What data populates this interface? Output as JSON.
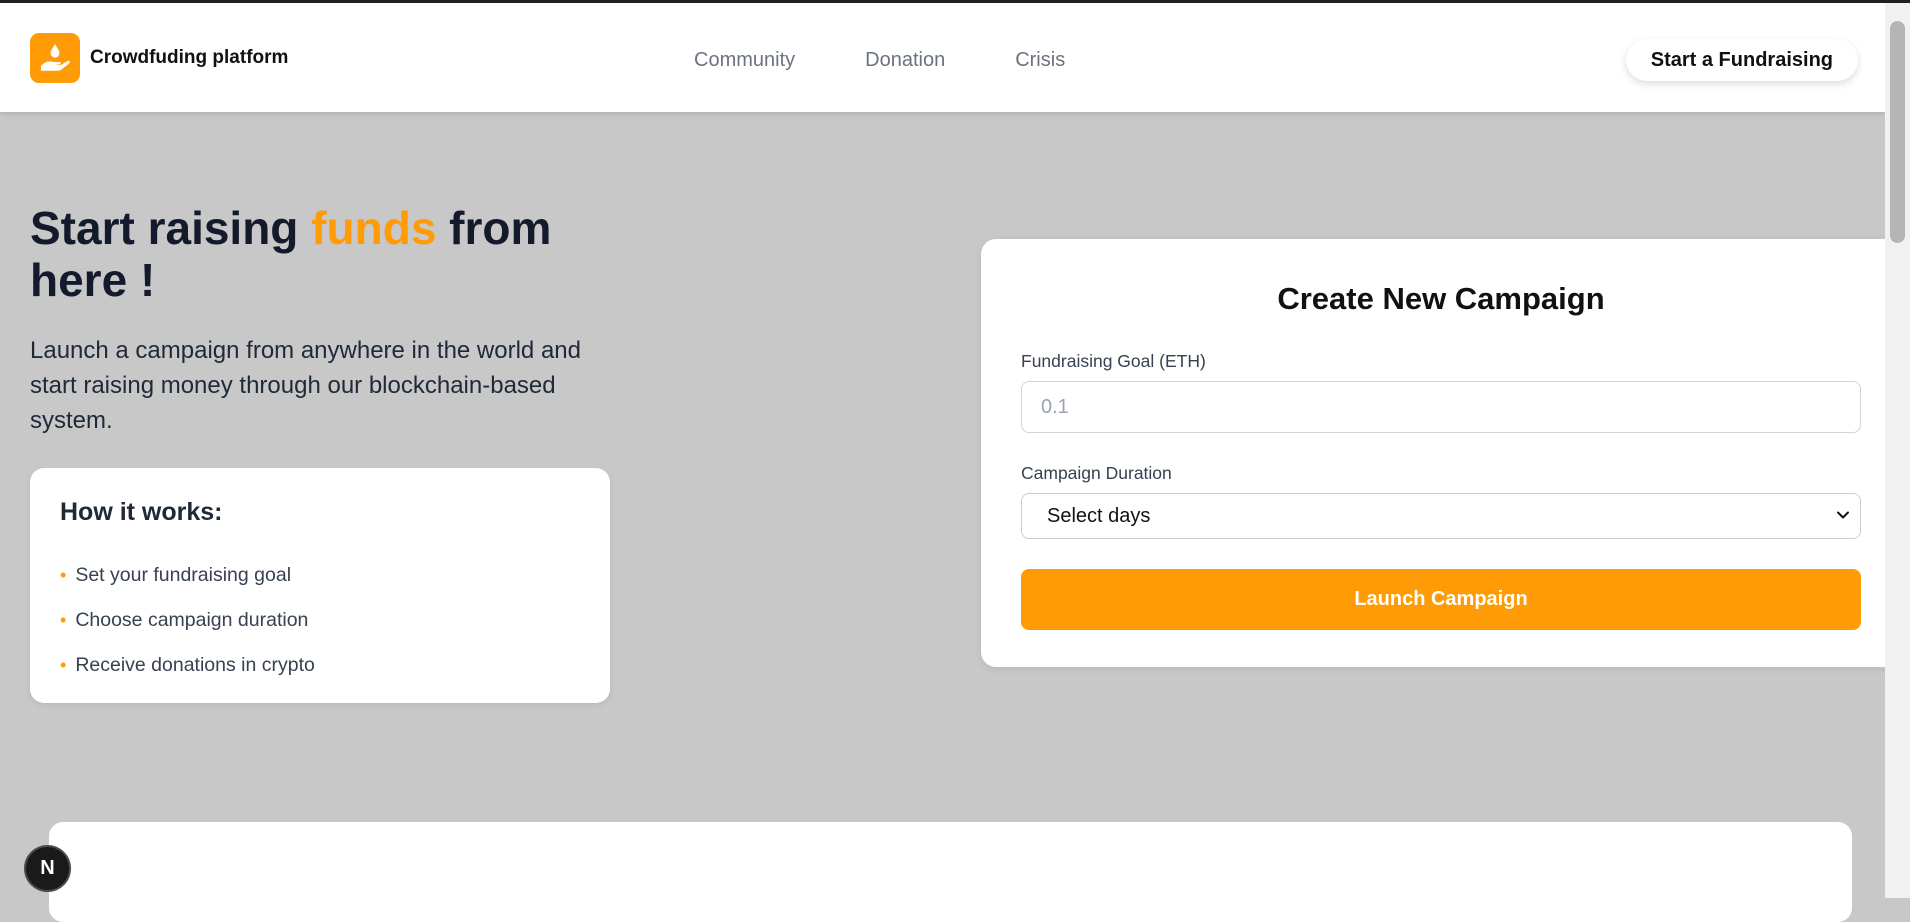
{
  "header": {
    "brand_name": "Crowdfuding platform",
    "nav": [
      "Community",
      "Donation",
      "Crisis"
    ],
    "cta_label": "Start a Fundraising"
  },
  "hero": {
    "title_part1": "Start raising ",
    "title_accent": "funds",
    "title_part2": " from here !",
    "description": "Launch a campaign from anywhere in the world and start raising money through our blockchain-based system."
  },
  "how_it_works": {
    "title": "How it works:",
    "items": [
      "Set your fundraising goal",
      "Choose campaign duration",
      "Receive donations in crypto"
    ]
  },
  "campaign_form": {
    "title": "Create New Campaign",
    "goal_label": "Fundraising Goal (ETH)",
    "goal_placeholder": "0.1",
    "duration_label": "Campaign Duration",
    "duration_selected": "Select days",
    "submit_label": "Launch Campaign"
  },
  "badge": {
    "letter": "N"
  },
  "icons": {
    "logo": "hand-droplet-icon",
    "select": "chevron-down-icon",
    "badge": "nextjs-icon"
  },
  "colors": {
    "accent": "#ff9b06",
    "background": "#c8c8c8",
    "heading": "#131a2b"
  }
}
